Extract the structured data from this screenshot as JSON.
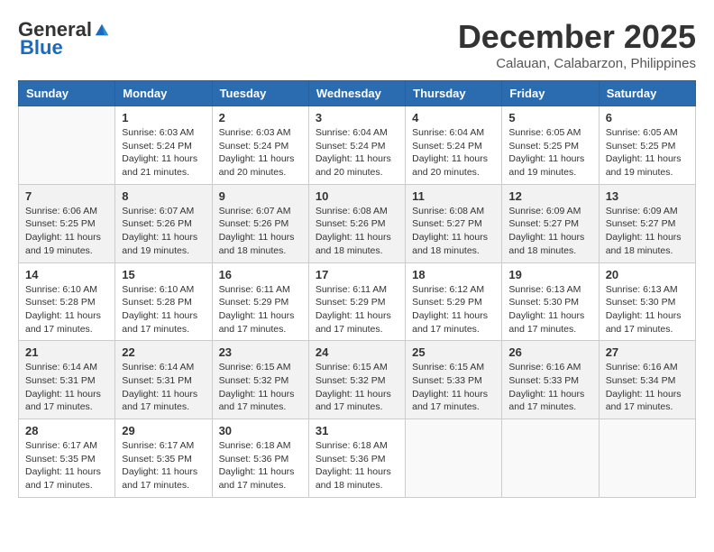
{
  "logo": {
    "general": "General",
    "blue": "Blue"
  },
  "header": {
    "month": "December 2025",
    "location": "Calauan, Calabarzon, Philippines"
  },
  "weekdays": [
    "Sunday",
    "Monday",
    "Tuesday",
    "Wednesday",
    "Thursday",
    "Friday",
    "Saturday"
  ],
  "weeks": [
    [
      {
        "day": "",
        "empty": true
      },
      {
        "day": "1",
        "sunrise": "6:03 AM",
        "sunset": "5:24 PM",
        "daylight": "11 hours and 21 minutes."
      },
      {
        "day": "2",
        "sunrise": "6:03 AM",
        "sunset": "5:24 PM",
        "daylight": "11 hours and 20 minutes."
      },
      {
        "day": "3",
        "sunrise": "6:04 AM",
        "sunset": "5:24 PM",
        "daylight": "11 hours and 20 minutes."
      },
      {
        "day": "4",
        "sunrise": "6:04 AM",
        "sunset": "5:24 PM",
        "daylight": "11 hours and 20 minutes."
      },
      {
        "day": "5",
        "sunrise": "6:05 AM",
        "sunset": "5:25 PM",
        "daylight": "11 hours and 19 minutes."
      },
      {
        "day": "6",
        "sunrise": "6:05 AM",
        "sunset": "5:25 PM",
        "daylight": "11 hours and 19 minutes."
      }
    ],
    [
      {
        "day": "7",
        "sunrise": "6:06 AM",
        "sunset": "5:25 PM",
        "daylight": "11 hours and 19 minutes."
      },
      {
        "day": "8",
        "sunrise": "6:07 AM",
        "sunset": "5:26 PM",
        "daylight": "11 hours and 19 minutes."
      },
      {
        "day": "9",
        "sunrise": "6:07 AM",
        "sunset": "5:26 PM",
        "daylight": "11 hours and 18 minutes."
      },
      {
        "day": "10",
        "sunrise": "6:08 AM",
        "sunset": "5:26 PM",
        "daylight": "11 hours and 18 minutes."
      },
      {
        "day": "11",
        "sunrise": "6:08 AM",
        "sunset": "5:27 PM",
        "daylight": "11 hours and 18 minutes."
      },
      {
        "day": "12",
        "sunrise": "6:09 AM",
        "sunset": "5:27 PM",
        "daylight": "11 hours and 18 minutes."
      },
      {
        "day": "13",
        "sunrise": "6:09 AM",
        "sunset": "5:27 PM",
        "daylight": "11 hours and 18 minutes."
      }
    ],
    [
      {
        "day": "14",
        "sunrise": "6:10 AM",
        "sunset": "5:28 PM",
        "daylight": "11 hours and 17 minutes."
      },
      {
        "day": "15",
        "sunrise": "6:10 AM",
        "sunset": "5:28 PM",
        "daylight": "11 hours and 17 minutes."
      },
      {
        "day": "16",
        "sunrise": "6:11 AM",
        "sunset": "5:29 PM",
        "daylight": "11 hours and 17 minutes."
      },
      {
        "day": "17",
        "sunrise": "6:11 AM",
        "sunset": "5:29 PM",
        "daylight": "11 hours and 17 minutes."
      },
      {
        "day": "18",
        "sunrise": "6:12 AM",
        "sunset": "5:29 PM",
        "daylight": "11 hours and 17 minutes."
      },
      {
        "day": "19",
        "sunrise": "6:13 AM",
        "sunset": "5:30 PM",
        "daylight": "11 hours and 17 minutes."
      },
      {
        "day": "20",
        "sunrise": "6:13 AM",
        "sunset": "5:30 PM",
        "daylight": "11 hours and 17 minutes."
      }
    ],
    [
      {
        "day": "21",
        "sunrise": "6:14 AM",
        "sunset": "5:31 PM",
        "daylight": "11 hours and 17 minutes."
      },
      {
        "day": "22",
        "sunrise": "6:14 AM",
        "sunset": "5:31 PM",
        "daylight": "11 hours and 17 minutes."
      },
      {
        "day": "23",
        "sunrise": "6:15 AM",
        "sunset": "5:32 PM",
        "daylight": "11 hours and 17 minutes."
      },
      {
        "day": "24",
        "sunrise": "6:15 AM",
        "sunset": "5:32 PM",
        "daylight": "11 hours and 17 minutes."
      },
      {
        "day": "25",
        "sunrise": "6:15 AM",
        "sunset": "5:33 PM",
        "daylight": "11 hours and 17 minutes."
      },
      {
        "day": "26",
        "sunrise": "6:16 AM",
        "sunset": "5:33 PM",
        "daylight": "11 hours and 17 minutes."
      },
      {
        "day": "27",
        "sunrise": "6:16 AM",
        "sunset": "5:34 PM",
        "daylight": "11 hours and 17 minutes."
      }
    ],
    [
      {
        "day": "28",
        "sunrise": "6:17 AM",
        "sunset": "5:35 PM",
        "daylight": "11 hours and 17 minutes."
      },
      {
        "day": "29",
        "sunrise": "6:17 AM",
        "sunset": "5:35 PM",
        "daylight": "11 hours and 17 minutes."
      },
      {
        "day": "30",
        "sunrise": "6:18 AM",
        "sunset": "5:36 PM",
        "daylight": "11 hours and 17 minutes."
      },
      {
        "day": "31",
        "sunrise": "6:18 AM",
        "sunset": "5:36 PM",
        "daylight": "11 hours and 18 minutes."
      },
      {
        "day": "",
        "empty": true
      },
      {
        "day": "",
        "empty": true
      },
      {
        "day": "",
        "empty": true
      }
    ]
  ]
}
